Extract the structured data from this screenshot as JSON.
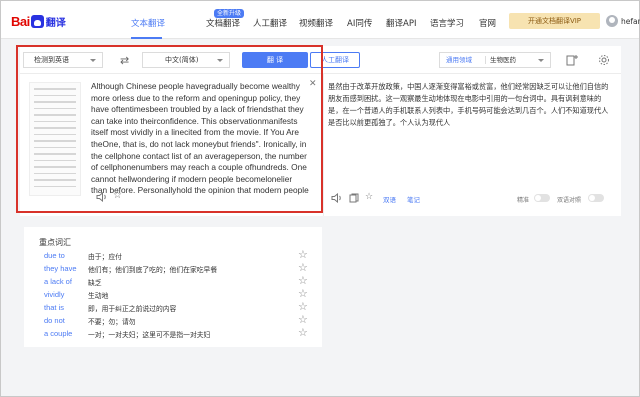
{
  "header": {
    "logo": {
      "part1": "Bai",
      "part2": "翻译"
    },
    "nav": [
      {
        "label": "文本翻译",
        "active": true
      },
      {
        "label": "文档翻译",
        "badge": "全新升级"
      },
      {
        "label": "人工翻译"
      },
      {
        "label": "视频翻译"
      },
      {
        "label": "AI同传"
      },
      {
        "label": "翻译API"
      },
      {
        "label": "语言学习"
      },
      {
        "label": "官网"
      }
    ],
    "vip_button": "开通文档翻译VIP",
    "username": "hefan62"
  },
  "toolbar": {
    "source_lang": "检测到英语",
    "target_lang": "中文(简体)",
    "translate_button": "翻 译",
    "human_button": "人工翻译",
    "domain_label": "通用领域",
    "domain_value": "生物医药"
  },
  "source": {
    "text": "Although Chinese people havegradually become wealthy more orless due to the reform and openingup policy, they have oftentimesbeen troubled by a lack of friendsthat they can take into theirconfidence. This observationmanifests itself most vividly in a linecited from the movie. If You Are theOne, that is, do not lack moneybut friends\". Ironically, in the cellphone contact list of an averageperson, the number of cellphonenumbers may reach a couple ofhundreds. One cannot hellwondering if modern people becomelonelier than before. Personallyhold the opinion that modern people"
  },
  "target": {
    "text": "虽然由于改革开放政策，中国人逐渐变得富裕或贫富，他们经常因缺乏可以让他们自信的朋友而感到困扰。这一观察最生动地体现在电影中引用的一句台词中。具有讽刺意味的是，在一个普通人的手机联系人列表中，手机号码可能会达到几百个。人们不知道现代人是否比以前更孤独了。个人认为现代人",
    "link_double": "双语",
    "link_notes": "笔记",
    "label_precise": "精准",
    "label_bilingual": "双语对照"
  },
  "keywords": {
    "title": "重点词汇",
    "items": [
      {
        "word": "due to",
        "meaning": "由于；应付"
      },
      {
        "word": "they have",
        "meaning": "他们有；他们到底了吃的；他们在家吃早餐"
      },
      {
        "word": "a lack of",
        "meaning": "缺乏"
      },
      {
        "word": "vividly",
        "meaning": "生动地"
      },
      {
        "word": "that is",
        "meaning": "即，用于纠正之前说过的内容"
      },
      {
        "word": "do not",
        "meaning": "不要；勿；请勿"
      },
      {
        "word": "a couple",
        "meaning": "一对；一对夫妇；这里可不是指一对夫妇"
      }
    ]
  },
  "colors": {
    "accent": "#4c7bf4",
    "highlight_box": "#d8322a",
    "brand_red": "#e10602"
  }
}
